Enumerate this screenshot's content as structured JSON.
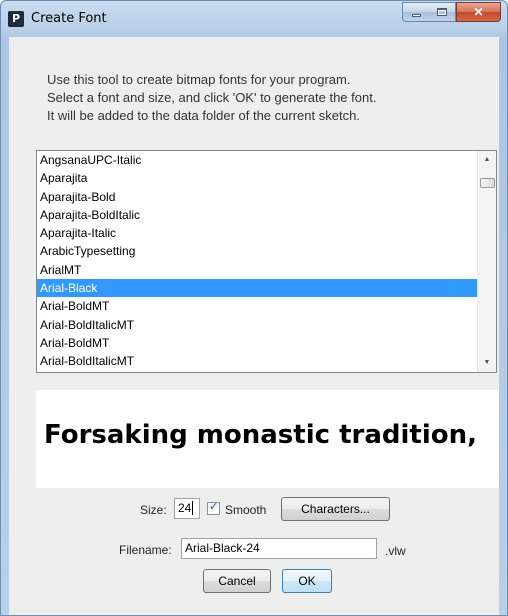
{
  "window": {
    "title": "Create Font",
    "app_icon_letter": "P"
  },
  "instructions": [
    "Use this tool to create bitmap fonts for your program.",
    "Select a font and size, and click 'OK' to generate the font.",
    "It will be added to the data folder of the current sketch."
  ],
  "font_list": {
    "items": [
      "AngsanaUPC-Italic",
      "Aparajita",
      "Aparajita-Bold",
      "Aparajita-BoldItalic",
      "Aparajita-Italic",
      "ArabicTypesetting",
      "ArialMT",
      "Arial-Black",
      "Arial-BoldMT",
      "Arial-BoldItalicMT",
      "Arial-BoldMT",
      "Arial-BoldItalicMT"
    ],
    "selected_index": 7
  },
  "preview": {
    "text": "Forsaking monastic tradition,"
  },
  "controls": {
    "size_label": "Size:",
    "size_value": "24",
    "smooth_label": "Smooth",
    "smooth_checked": true,
    "characters_button": "Characters...",
    "filename_label": "Filename:",
    "filename_value": "Arial-Black-24",
    "extension": ".vlw",
    "cancel_button": "Cancel",
    "ok_button": "OK"
  }
}
